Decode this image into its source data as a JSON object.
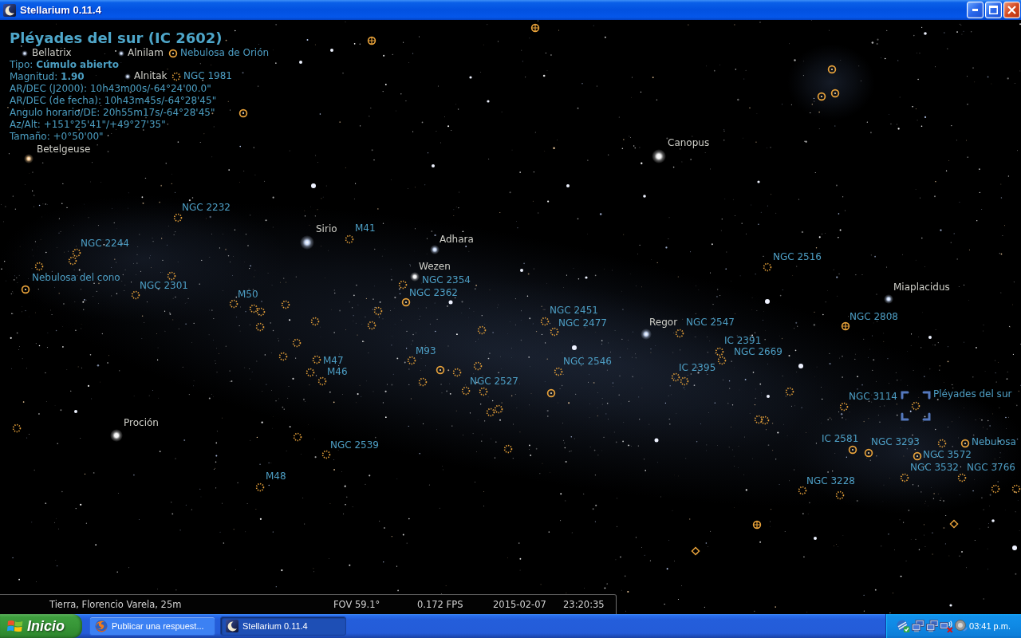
{
  "window": {
    "title": "Stellarium 0.11.4"
  },
  "info_panel": {
    "title": "Pléyades del sur (IC 2602)",
    "lines": [
      "Tipo: **Cúmulo abierto**",
      "Magnitud: **1.90**",
      "AR/DEC (J2000): 10h43m00s/-64°24'00.0\"",
      "AR/DEC (de fecha): 10h43m45s/-64°28'45\"",
      "Angulo horario/DE: 20h55m17s/-64°28'45\"",
      "Az/Alt: +151°25'41\"/+49°27'35\"",
      "Tamaño: +0°50'00\""
    ]
  },
  "sky_objects": [
    {
      "kind": "star",
      "label": "Bellatrix",
      "selected": false
    },
    {
      "kind": "star",
      "label": "Alnilam",
      "selected": false
    },
    {
      "kind": "nebula",
      "label": "Nebulosa de Orión",
      "selected": false
    },
    {
      "kind": "star",
      "label": "Alnitak",
      "selected": false
    },
    {
      "kind": "open_cluster",
      "label": "NGC 1981",
      "selected": false
    },
    {
      "kind": "star",
      "label": "Betelgeuse",
      "selected": false
    },
    {
      "kind": "star",
      "label": "Canopus",
      "selected": false
    },
    {
      "kind": "open_cluster",
      "label": "NGC 2232",
      "selected": false
    },
    {
      "kind": "star",
      "label": "Sirio",
      "selected": false
    },
    {
      "kind": "open_cluster",
      "label": "M41",
      "selected": false
    },
    {
      "kind": "open_cluster",
      "label": "NGC 2244",
      "selected": false
    },
    {
      "kind": "star",
      "label": "Adhara",
      "selected": false
    },
    {
      "kind": "open_cluster",
      "label": "NGC 2516",
      "selected": false
    },
    {
      "kind": "star",
      "label": "Wezen",
      "selected": false
    },
    {
      "kind": "nebula",
      "label": "Nebulosa del cono",
      "selected": false
    },
    {
      "kind": "open_cluster",
      "label": "NGC 2301",
      "selected": false
    },
    {
      "kind": "open_cluster",
      "label": "NGC 2354",
      "selected": false
    },
    {
      "kind": "open_cluster",
      "label": "M50",
      "selected": false
    },
    {
      "kind": "nebula",
      "label": "NGC 2362",
      "selected": false
    },
    {
      "kind": "star",
      "label": "Miaplacidus",
      "selected": false
    },
    {
      "kind": "open_cluster",
      "label": "NGC 2451",
      "selected": false
    },
    {
      "kind": "open_cluster",
      "label": "NGC 2477",
      "selected": false
    },
    {
      "kind": "star",
      "label": "Regor",
      "selected": false
    },
    {
      "kind": "open_cluster",
      "label": "NGC 2547",
      "selected": false
    },
    {
      "kind": "globular_cluster",
      "label": "NGC 2808",
      "selected": false
    },
    {
      "kind": "open_cluster",
      "label": "IC 2391",
      "selected": false
    },
    {
      "kind": "open_cluster",
      "label": "M93",
      "selected": false
    },
    {
      "kind": "open_cluster",
      "label": "NGC 2669",
      "selected": false
    },
    {
      "kind": "open_cluster",
      "label": "M47",
      "selected": false
    },
    {
      "kind": "open_cluster",
      "label": "NGC 2546",
      "selected": false
    },
    {
      "kind": "open_cluster",
      "label": "M46",
      "selected": false
    },
    {
      "kind": "open_cluster",
      "label": "IC 2395",
      "selected": false
    },
    {
      "kind": "open_cluster",
      "label": "NGC 2527",
      "selected": false
    },
    {
      "kind": "open_cluster",
      "label": "NGC 3114",
      "selected": false
    },
    {
      "kind": "open_cluster",
      "label": "Pléyades del sur",
      "selected": true
    },
    {
      "kind": "star",
      "label": "Proción",
      "selected": false
    },
    {
      "kind": "open_cluster",
      "label": "NGC 2539",
      "selected": false
    },
    {
      "kind": "nebula",
      "label": "IC 2581",
      "selected": false
    },
    {
      "kind": "nebula",
      "label": "NGC 3293",
      "selected": false
    },
    {
      "kind": "nebula",
      "label": "Nebulosa",
      "selected": false
    },
    {
      "kind": "nebula",
      "label": "NGC 3572",
      "selected": false
    },
    {
      "kind": "open_cluster",
      "label": "NGC 3532",
      "selected": false
    },
    {
      "kind": "open_cluster",
      "label": "NGC 3766",
      "selected": false
    },
    {
      "kind": "open_cluster",
      "label": "M48",
      "selected": false
    },
    {
      "kind": "open_cluster",
      "label": "NGC 3228",
      "selected": false
    }
  ],
  "status_bar": {
    "location": "Tierra, Florencio Varela, 25m",
    "fov": "FOV 59.1°",
    "fps": "0.172 FPS",
    "date": "2015-02-07",
    "time": "23:20:35"
  },
  "taskbar": {
    "start": "Inicio",
    "tasks": [
      {
        "kind": "browser",
        "label": "Publicar una respuest...",
        "selected": false
      },
      {
        "kind": "stellarium",
        "label": "Stellarium 0.11.4",
        "selected": true
      }
    ],
    "clock": "03:41 p.m."
  }
}
